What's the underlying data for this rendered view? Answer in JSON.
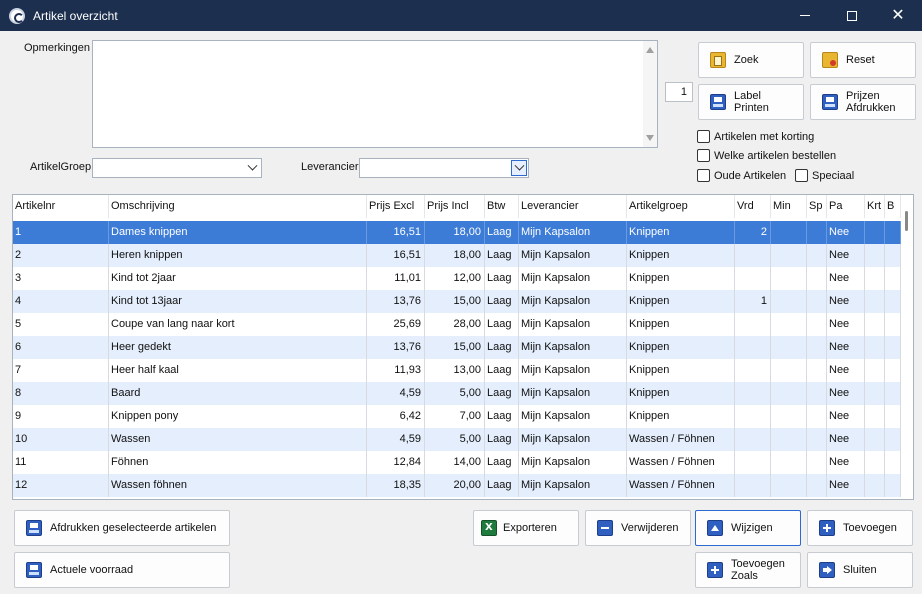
{
  "window": {
    "title": "Artikel overzicht"
  },
  "form": {
    "opmerkingen_label": "Opmerkingen",
    "opmerkingen_value": "",
    "artikelgroep_label": "ArtikelGroep",
    "artikelgroep_value": "",
    "leverancier_label": "Leverancier",
    "leverancier_value": "",
    "counter_value": "1"
  },
  "buttons": {
    "zoek": "Zoek",
    "reset": "Reset",
    "label_printen": [
      "Label",
      "Printen"
    ],
    "prijzen_afdrukken": [
      "Prijzen",
      "Afdrukken"
    ],
    "afdrukken_geselecteerde": "Afdrukken geselecteerde artikelen",
    "actuele_voorraad": "Actuele voorraad",
    "exporteren": "Exporteren",
    "verwijderen": "Verwijderen",
    "wijzigen": "Wijzigen",
    "toevoegen": "Toevoegen",
    "toevoegen_zoals": [
      "Toevoegen",
      "Zoals"
    ],
    "sluiten": "Sluiten"
  },
  "checkboxes": {
    "met_korting": "Artikelen met korting",
    "bestellen": "Welke artikelen bestellen",
    "oude": "Oude Artikelen",
    "speciaal": "Speciaal"
  },
  "grid": {
    "columns": [
      "Artikelnr",
      "Omschrijving",
      "Prijs Excl",
      "Prijs Incl",
      "Btw",
      "Leverancier",
      "Artikelgroep",
      "Vrd",
      "Min",
      "Sp",
      "Pa",
      "Krt",
      "B"
    ],
    "selected_row": 0,
    "rows": [
      [
        "1",
        "Dames knippen",
        "16,51",
        "18,00",
        "Laag",
        "Mijn Kapsalon",
        "Knippen",
        "2",
        "",
        "",
        "Nee",
        "",
        ""
      ],
      [
        "2",
        "Heren knippen",
        "16,51",
        "18,00",
        "Laag",
        "Mijn Kapsalon",
        "Knippen",
        "",
        "",
        "",
        "Nee",
        "",
        ""
      ],
      [
        "3",
        "Kind tot 2jaar",
        "11,01",
        "12,00",
        "Laag",
        "Mijn Kapsalon",
        "Knippen",
        "",
        "",
        "",
        "Nee",
        "",
        ""
      ],
      [
        "4",
        "Kind tot 13jaar",
        "13,76",
        "15,00",
        "Laag",
        "Mijn Kapsalon",
        "Knippen",
        "1",
        "",
        "",
        "Nee",
        "",
        ""
      ],
      [
        "5",
        "Coupe van lang naar kort",
        "25,69",
        "28,00",
        "Laag",
        "Mijn Kapsalon",
        "Knippen",
        "",
        "",
        "",
        "Nee",
        "",
        ""
      ],
      [
        "6",
        "Heer gedekt",
        "13,76",
        "15,00",
        "Laag",
        "Mijn Kapsalon",
        "Knippen",
        "",
        "",
        "",
        "Nee",
        "",
        ""
      ],
      [
        "7",
        "Heer half kaal",
        "11,93",
        "13,00",
        "Laag",
        "Mijn Kapsalon",
        "Knippen",
        "",
        "",
        "",
        "Nee",
        "",
        ""
      ],
      [
        "8",
        "Baard",
        "4,59",
        "5,00",
        "Laag",
        "Mijn Kapsalon",
        "Knippen",
        "",
        "",
        "",
        "Nee",
        "",
        ""
      ],
      [
        "9",
        "Knippen pony",
        "6,42",
        "7,00",
        "Laag",
        "Mijn Kapsalon",
        "Knippen",
        "",
        "",
        "",
        "Nee",
        "",
        ""
      ],
      [
        "10",
        "Wassen",
        "4,59",
        "5,00",
        "Laag",
        "Mijn Kapsalon",
        "Wassen / Föhnen",
        "",
        "",
        "",
        "Nee",
        "",
        ""
      ],
      [
        "11",
        "Föhnen",
        "12,84",
        "14,00",
        "Laag",
        "Mijn Kapsalon",
        "Wassen / Föhnen",
        "",
        "",
        "",
        "Nee",
        "",
        ""
      ],
      [
        "12",
        "Wassen föhnen",
        "18,35",
        "20,00",
        "Laag",
        "Mijn Kapsalon",
        "Wassen / Föhnen",
        "",
        "",
        "",
        "Nee",
        "",
        ""
      ]
    ]
  }
}
